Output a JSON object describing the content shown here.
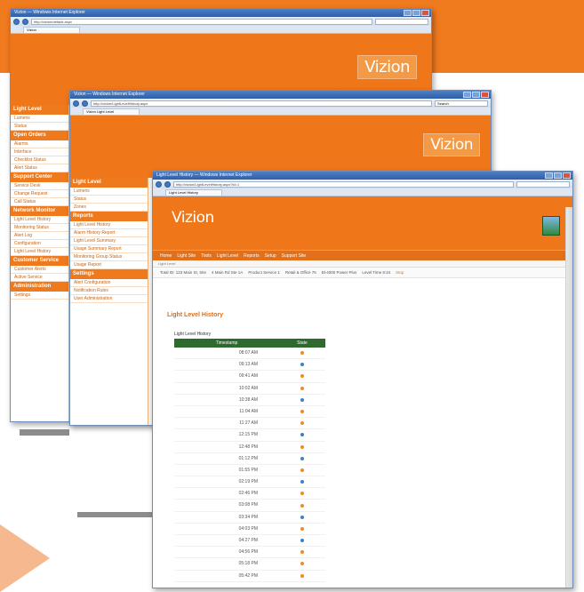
{
  "colors": {
    "brand_orange": "#ef7619",
    "banner_orange": "#f07a1e",
    "grid_header_green": "#2d6a2b",
    "arrow_peach": "#f6b88e"
  },
  "win1": {
    "title": "Vizion — Windows Internet Explorer",
    "address": "http://vizion/default.aspx",
    "tab": "Vizion",
    "logo": "Vizion",
    "sidebar": [
      {
        "type": "section",
        "label": "Light Level"
      },
      {
        "type": "link",
        "label": "Lumens"
      },
      {
        "type": "link",
        "label": "Status"
      },
      {
        "type": "section",
        "label": "Open Orders"
      },
      {
        "type": "link",
        "label": "Alarms"
      },
      {
        "type": "link",
        "label": "Interface"
      },
      {
        "type": "link",
        "label": "Checklist Status"
      },
      {
        "type": "link",
        "label": "Alert Status"
      },
      {
        "type": "section",
        "label": "Support Center"
      },
      {
        "type": "link",
        "label": "Service Desk"
      },
      {
        "type": "link",
        "label": "Change Request"
      },
      {
        "type": "link",
        "label": "Call Status"
      },
      {
        "type": "section",
        "label": "Network Monitor"
      },
      {
        "type": "link",
        "label": "Light Level History"
      },
      {
        "type": "link",
        "label": "Monitoring Status"
      },
      {
        "type": "link",
        "label": "Alert Log"
      },
      {
        "type": "link",
        "label": "Configuration"
      },
      {
        "type": "link",
        "label": "Light Level History"
      },
      {
        "type": "section",
        "label": "Customer Service"
      },
      {
        "type": "link",
        "label": "Customer Alerts"
      },
      {
        "type": "link",
        "label": "Active Service"
      },
      {
        "type": "section",
        "label": "Administration"
      },
      {
        "type": "link",
        "label": "Settings"
      }
    ]
  },
  "win2": {
    "title": "Vizion — Windows Internet Explorer",
    "address": "http://vizion/LightLevelHistory.aspx",
    "tab": "Vizion Light Level",
    "logo": "Vizion",
    "search": "Search",
    "sidebar": [
      {
        "type": "section",
        "label": "Light Level"
      },
      {
        "type": "link",
        "label": "Lumens"
      },
      {
        "type": "link",
        "label": "Status"
      },
      {
        "type": "link",
        "label": "Zones"
      },
      {
        "type": "section",
        "label": "Reports"
      },
      {
        "type": "link",
        "label": "Light Level History"
      },
      {
        "type": "link",
        "label": "Alarm History Report"
      },
      {
        "type": "link",
        "label": "Light Level Summary"
      },
      {
        "type": "link",
        "label": "Usage Summary Report"
      },
      {
        "type": "link",
        "label": "Monitoring Group Status"
      },
      {
        "type": "link",
        "label": "Usage Report"
      },
      {
        "type": "section",
        "label": "Settings"
      },
      {
        "type": "link",
        "label": "Alert Configuration"
      },
      {
        "type": "link",
        "label": "Notification Rules"
      },
      {
        "type": "link",
        "label": "User Administration"
      }
    ]
  },
  "win3": {
    "title": "Light Level History — Windows Internet Explorer",
    "address": "http://vizion/LightLevelHistory.aspx?id=1",
    "tab": "Light Level History",
    "logo": "Vizion",
    "menu": [
      "Home",
      "Light Site",
      "Tools",
      "Light Level",
      "Reports",
      "Setup",
      "Support Site"
    ],
    "crumb": "Light Level",
    "stats": [
      {
        "label": "Total ID: 123 Main St, Site",
        "hl": false
      },
      {
        "label": "4 Main Rd Ste 1A",
        "hl": false
      },
      {
        "label": "Product Service 1",
        "hl": false
      },
      {
        "label": "Retail & Office 76",
        "hl": false
      },
      {
        "label": "Bl-4000 Power Plus",
        "hl": false
      },
      {
        "label": "Level Time 9:34",
        "hl": false
      },
      {
        "label": "Stop",
        "hl": true
      }
    ],
    "page_title": "Light Level History",
    "grid": {
      "caption": "Light Level History",
      "columns": [
        "Timestamp",
        "State"
      ],
      "rows": [
        {
          "time": "08:07 AM",
          "state": "high"
        },
        {
          "time": "09:13 AM",
          "state": "low"
        },
        {
          "time": "09:41 AM",
          "state": "high"
        },
        {
          "time": "10:02 AM",
          "state": "high"
        },
        {
          "time": "10:38 AM",
          "state": "low"
        },
        {
          "time": "11:04 AM",
          "state": "high"
        },
        {
          "time": "11:27 AM",
          "state": "high"
        },
        {
          "time": "12:15 PM",
          "state": "low"
        },
        {
          "time": "12:48 PM",
          "state": "high"
        },
        {
          "time": "01:12 PM",
          "state": "low"
        },
        {
          "time": "01:55 PM",
          "state": "high"
        },
        {
          "time": "02:19 PM",
          "state": "low"
        },
        {
          "time": "02:46 PM",
          "state": "high"
        },
        {
          "time": "03:08 PM",
          "state": "high"
        },
        {
          "time": "03:34 PM",
          "state": "low"
        },
        {
          "time": "04:03 PM",
          "state": "high"
        },
        {
          "time": "04:27 PM",
          "state": "low"
        },
        {
          "time": "04:56 PM",
          "state": "high"
        },
        {
          "time": "05:18 PM",
          "state": "high"
        },
        {
          "time": "05:42 PM",
          "state": "high"
        }
      ]
    }
  }
}
